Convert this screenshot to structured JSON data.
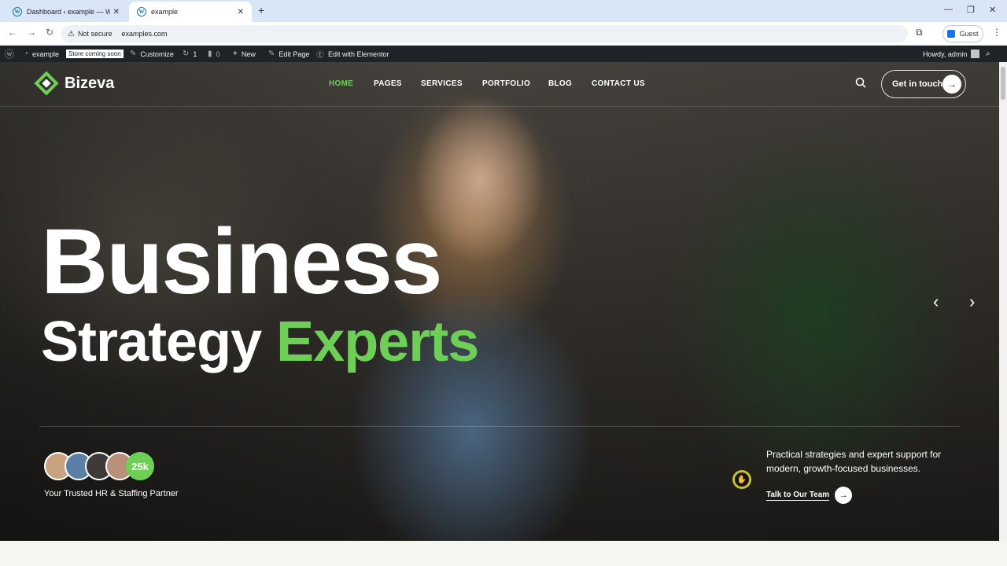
{
  "browser": {
    "tabs": [
      {
        "title": "Dashboard ‹ example — WordPress",
        "icon": "wordpress-icon"
      },
      {
        "title": "example",
        "icon": "wordpress-icon"
      }
    ],
    "security_label": "Not secure",
    "url": "examples.com",
    "profile_label": "Guest"
  },
  "adminbar": {
    "site_name": "example",
    "store_badge": "Store coming soon",
    "customize": "Customize",
    "updates_count": "1",
    "comments_count": "0",
    "new_label": "New",
    "edit_page": "Edit Page",
    "edit_elementor": "Edit with Elementor",
    "howdy": "Howdy, admin"
  },
  "site": {
    "logo_text": "Bizeva",
    "nav": [
      "HOME",
      "PAGES",
      "SERVICES",
      "PORTFOLIO",
      "BLOG",
      "CONTACT US"
    ],
    "cta_label": "Get in touch"
  },
  "hero": {
    "headline_line1": "Business",
    "headline_word1": "Strategy",
    "headline_accent": "Experts",
    "avatar_count": "25k",
    "trusted_text": "Your Trusted HR & Staffing Partner",
    "description": "Practical strategies and expert support for modern, growth-focused businesses.",
    "talk_label": "Talk to Our Team"
  },
  "colors": {
    "accent": "#6ecf56",
    "adminbar_bg": "#1d2327"
  }
}
